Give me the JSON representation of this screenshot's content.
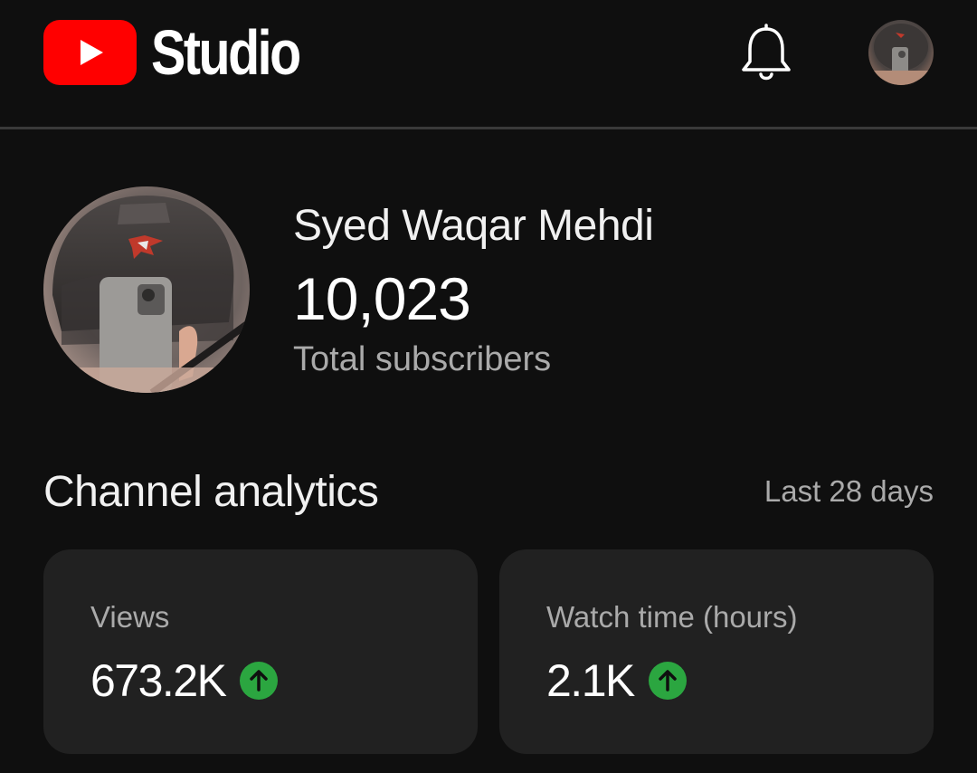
{
  "header": {
    "app_name": "Studio",
    "logo_icon": "youtube-play-icon",
    "notification_icon": "bell-icon",
    "account_avatar": "avatar"
  },
  "channel": {
    "name": "Syed Waqar Mehdi",
    "subscriber_count": "10,023",
    "subscriber_label": "Total subscribers"
  },
  "analytics": {
    "title": "Channel analytics",
    "period": "Last 28 days",
    "cards": [
      {
        "label": "Views",
        "value": "673.2K",
        "trend": "up",
        "trend_icon": "arrow-up-icon"
      },
      {
        "label": "Watch time (hours)",
        "value": "2.1K",
        "trend": "up",
        "trend_icon": "arrow-up-icon"
      }
    ]
  },
  "colors": {
    "background": "#0f0f0f",
    "card": "#212121",
    "brand_red": "#ff0000",
    "trend_up": "#2ba640",
    "secondary_text": "#aaaaaa"
  }
}
